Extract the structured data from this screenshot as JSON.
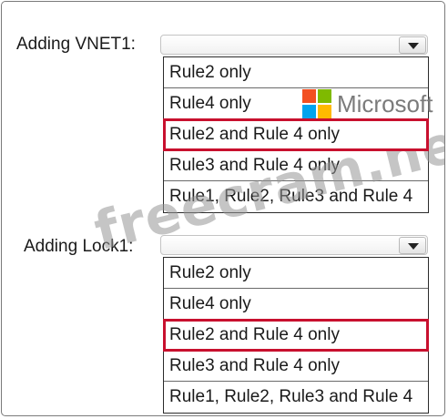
{
  "section_vnet": {
    "label": "Adding VNET1:",
    "options": [
      "Rule2 only",
      "Rule4 only",
      "Rule2 and Rule 4 only",
      "Rule3 and Rule 4 only",
      "Rule1, Rule2, Rule3 and Rule 4"
    ],
    "highlighted_option": "Rule2 and Rule 4 only"
  },
  "section_lock": {
    "label": "Adding Lock1:",
    "options": [
      "Rule2 only",
      "Rule4 only",
      "Rule2 and Rule 4 only",
      "Rule3 and Rule 4 only",
      "Rule1, Rule2, Rule3 and Rule 4"
    ],
    "highlighted_option": "Rule2 and Rule 4 only"
  },
  "branding": {
    "logo_text": "Microsoft",
    "logo_colors": [
      "#f25022",
      "#7fba00",
      "#00a4ef",
      "#ffb900"
    ],
    "watermark": "freecram.net"
  },
  "colors": {
    "highlight_border": "#c8102e"
  }
}
